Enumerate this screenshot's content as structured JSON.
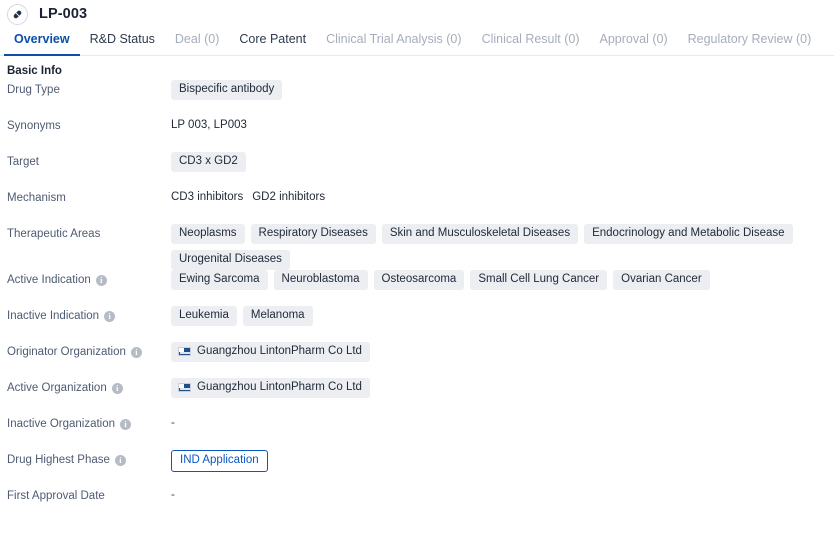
{
  "header": {
    "icon": "pill-capsule-icon",
    "title": "LP-003"
  },
  "tabs": [
    {
      "label": "Overview",
      "active": true,
      "muted": false
    },
    {
      "label": "R&D Status",
      "active": false,
      "muted": false
    },
    {
      "label": "Deal (0)",
      "active": false,
      "muted": true
    },
    {
      "label": "Core Patent",
      "active": false,
      "muted": false
    },
    {
      "label": "Clinical Trial Analysis (0)",
      "active": false,
      "muted": true
    },
    {
      "label": "Clinical Result (0)",
      "active": false,
      "muted": true
    },
    {
      "label": "Approval (0)",
      "active": false,
      "muted": true
    },
    {
      "label": "Regulatory Review (0)",
      "active": false,
      "muted": true
    }
  ],
  "section": {
    "title": "Basic Info"
  },
  "rows": {
    "drug_type": {
      "label": "Drug Type",
      "tags": [
        "Bispecific antibody"
      ]
    },
    "synonyms": {
      "label": "Synonyms",
      "text": "LP 003,  LP003"
    },
    "target": {
      "label": "Target",
      "tags": [
        "CD3 x GD2"
      ]
    },
    "mechanism": {
      "label": "Mechanism",
      "items": [
        "CD3 inhibitors",
        "GD2 inhibitors"
      ]
    },
    "therapeutic_areas": {
      "label": "Therapeutic Areas",
      "tags": [
        "Neoplasms",
        "Respiratory Diseases",
        "Skin and Musculoskeletal Diseases",
        "Endocrinology and Metabolic Disease",
        "Urogenital Diseases"
      ]
    },
    "active_indication": {
      "label": "Active Indication",
      "has_info": true,
      "tags": [
        "Ewing Sarcoma",
        "Neuroblastoma",
        "Osteosarcoma",
        "Small Cell Lung Cancer",
        "Ovarian Cancer"
      ]
    },
    "inactive_indication": {
      "label": "Inactive Indication",
      "has_info": true,
      "tags": [
        "Leukemia",
        "Melanoma"
      ]
    },
    "originator_organization": {
      "label": "Originator Organization",
      "has_info": true,
      "orgs": [
        "Guangzhou LintonPharm Co Ltd"
      ]
    },
    "active_organization": {
      "label": "Active Organization",
      "has_info": true,
      "orgs": [
        "Guangzhou LintonPharm Co Ltd"
      ]
    },
    "inactive_organization": {
      "label": "Inactive Organization",
      "has_info": true,
      "text": "-"
    },
    "drug_highest_phase": {
      "label": "Drug Highest Phase",
      "has_info": true,
      "badge": "IND Application"
    },
    "first_approval_date": {
      "label": "First Approval Date",
      "has_info": false,
      "text": "-"
    }
  },
  "colors": {
    "accent": "#0b4fa8",
    "badge_blue": "#0b57c2",
    "tag_bg": "#eceef2",
    "label_text": "#4e5b70",
    "muted_tab": "#a6adba"
  }
}
